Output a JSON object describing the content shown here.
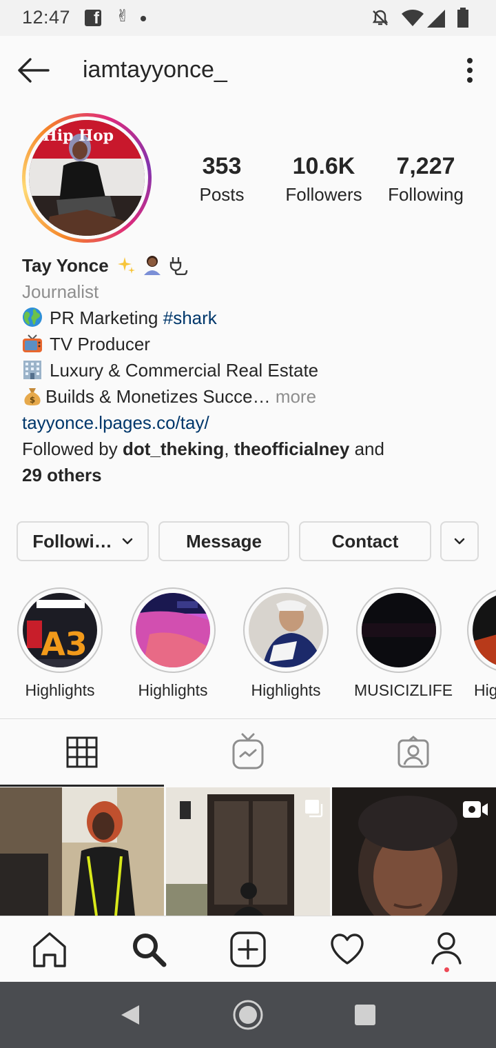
{
  "status_bar": {
    "time": "12:47"
  },
  "header": {
    "username": "iamtayyonce_"
  },
  "stats": [
    {
      "value": "353",
      "label": "Posts"
    },
    {
      "value": "10.6K",
      "label": "Followers"
    },
    {
      "value": "7,227",
      "label": "Following"
    }
  ],
  "avatar": {
    "sign_text": "Hip Hop"
  },
  "bio": {
    "name": "Tay Yonce",
    "category": "Journalist",
    "line1_text": "PR Marketing ",
    "line1_hashtag": "#shark",
    "line2": "TV Producer",
    "line3": "Luxury & Commercial Real Estate",
    "line4": "Builds & Monetizes Succe…",
    "more": " more",
    "link": "tayyonce.lpages.co/tay/",
    "followed_prefix": "Followed by ",
    "follower1": "dot_theking",
    "sep": ", ",
    "follower2": "theofficialney",
    "followed_and": " and",
    "others": "29 others"
  },
  "buttons": {
    "following": "Followi…",
    "message": "Message",
    "contact": "Contact"
  },
  "highlights": [
    {
      "label": "Highlights"
    },
    {
      "label": "Highlights"
    },
    {
      "label": "Highlights"
    },
    {
      "label": "MUSICIZLIFE"
    },
    {
      "label": "Hig"
    }
  ],
  "colors": {
    "accent_link": "#00376b",
    "muted": "#8e8e8e",
    "text": "#262626",
    "notification_dot": "#ed4956"
  },
  "icons": {
    "tabs": [
      "grid-icon",
      "igtv-icon",
      "tagged-icon"
    ],
    "bottom_nav": [
      "home-icon",
      "search-icon",
      "add-post-icon",
      "heart-icon",
      "profile-icon"
    ]
  }
}
